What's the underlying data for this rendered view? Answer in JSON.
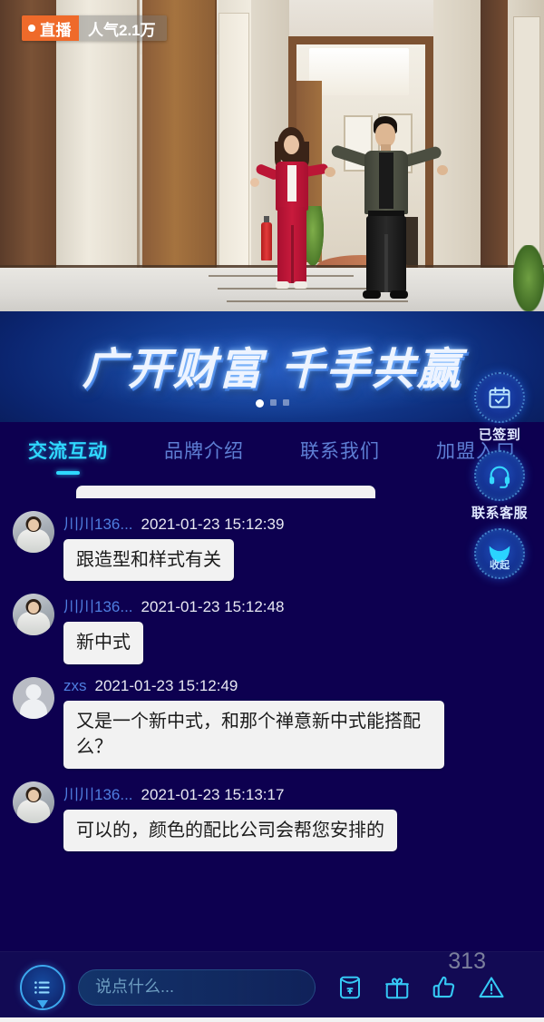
{
  "video": {
    "live_label": "直播",
    "popularity": "人气2.1万",
    "live_dot_color": "#ffffff",
    "live_badge_color": "#ef6a2a"
  },
  "banner": {
    "title": "广开财富  千手共赢",
    "dots": [
      "active",
      "inactive",
      "inactive"
    ],
    "accent_color": "#2e6bd6"
  },
  "tabs": [
    {
      "label": "交流互动",
      "active": true
    },
    {
      "label": "品牌介绍",
      "active": false
    },
    {
      "label": "联系我们",
      "active": false
    },
    {
      "label": "加盟入口",
      "active": false
    }
  ],
  "tab_active_color": "#2fd8ff",
  "chat": {
    "messages": [
      {
        "user": "川川136...",
        "time": "2021-01-23 15:12:39",
        "text": "跟造型和样式有关",
        "avatar": "photo"
      },
      {
        "user": "川川136...",
        "time": "2021-01-23 15:12:48",
        "text": "新中式",
        "avatar": "photo"
      },
      {
        "user": "zxs",
        "time": "2021-01-23 15:12:49",
        "text": "又是一个新中式，和那个禅意新中式能搭配么？",
        "avatar": "default"
      },
      {
        "user": "川川136...",
        "time": "2021-01-23 15:13:17",
        "text": "可以的，颜色的配比公司会帮您安排的",
        "avatar": "photo"
      }
    ]
  },
  "floats": [
    {
      "icon": "calendar-check-icon",
      "label": "已签到"
    },
    {
      "icon": "headset-icon",
      "label": "联系客服"
    },
    {
      "icon": "chevron-down-icon",
      "label": "收起"
    }
  ],
  "bottom": {
    "menu_icon": "list-menu-icon",
    "input_placeholder": "说点什么...",
    "input_value": "",
    "like_count": "313",
    "actions": [
      {
        "icon": "red-envelope-icon",
        "name": "red-envelope"
      },
      {
        "icon": "gift-icon",
        "name": "gift"
      },
      {
        "icon": "thumbs-up-icon",
        "name": "like"
      },
      {
        "icon": "warning-icon",
        "name": "report"
      }
    ]
  }
}
